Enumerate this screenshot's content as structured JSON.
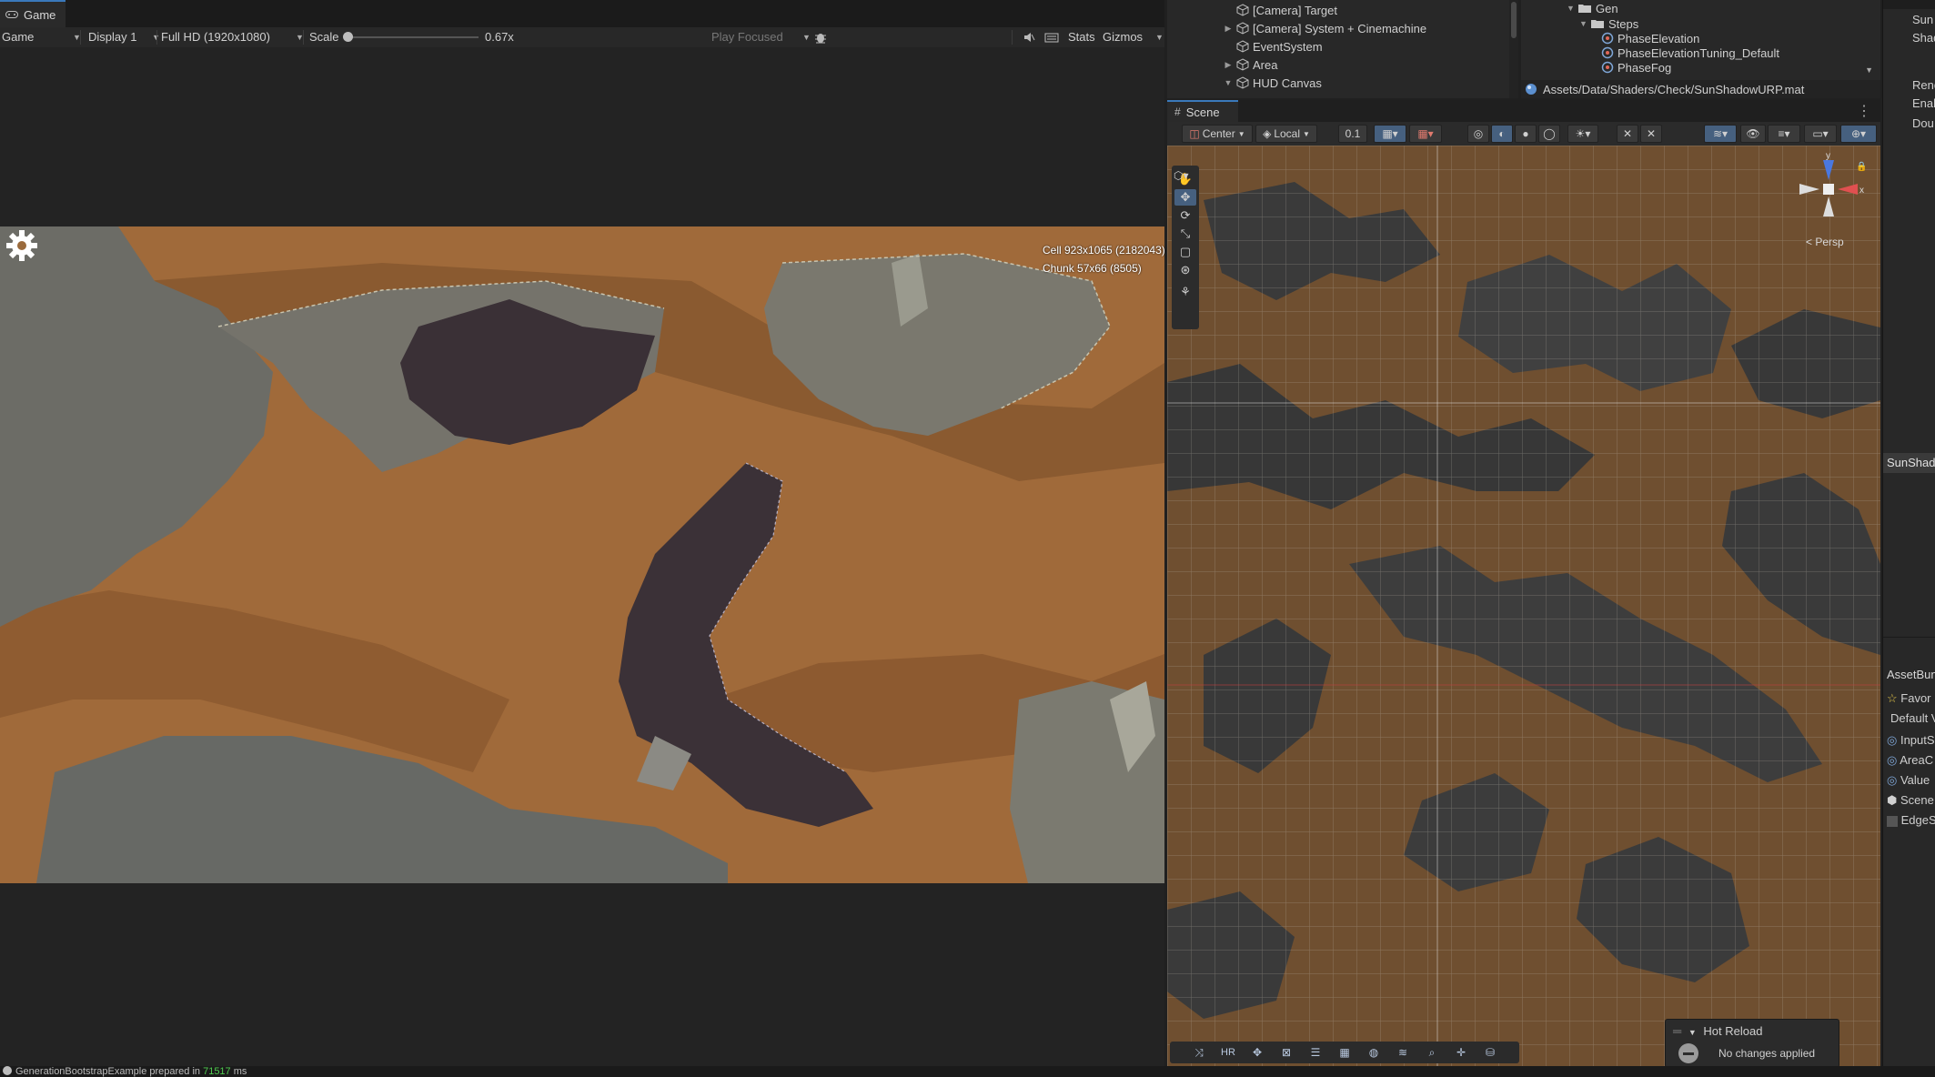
{
  "game": {
    "tab_label": "Game",
    "toolbar": {
      "mode": "Game",
      "display": "Display 1",
      "resolution": "Full HD (1920x1080)",
      "scale_label": "Scale",
      "scale_value": "0.67x",
      "play_mode": "Play Focused",
      "stats": "Stats",
      "gizmos": "Gizmos"
    },
    "overlay": {
      "cell": "Cell 923x1065 (2182043)",
      "chunk": "Chunk 57x66 (8505)"
    }
  },
  "hierarchy": {
    "items": [
      {
        "label": "[Camera] Target",
        "expanded": null
      },
      {
        "label": "[Camera] System + Cinemachine",
        "expanded": false
      },
      {
        "label": "EventSystem",
        "expanded": null
      },
      {
        "label": "Area",
        "expanded": false
      },
      {
        "label": "HUD Canvas",
        "expanded": true
      }
    ]
  },
  "project": {
    "tree": [
      {
        "label": "Gen",
        "kind": "folder"
      },
      {
        "label": "Steps",
        "kind": "folder"
      },
      {
        "label": "PhaseElevation",
        "kind": "asset"
      },
      {
        "label": "PhaseElevationTuning_Default",
        "kind": "asset"
      },
      {
        "label": "PhaseFog",
        "kind": "asset"
      }
    ],
    "selected_path": "Assets/Data/Shaders/Check/SunShadowURP.mat"
  },
  "scene": {
    "tab_label": "Scene",
    "toolbar": {
      "pivot": "Center",
      "space": "Local",
      "snap_value": "0.1"
    },
    "gizmo": {
      "y_axis": "y",
      "x_axis": "x",
      "projection": "< Persp"
    },
    "hot_reload": {
      "title": "Hot Reload",
      "status": "No changes applied"
    }
  },
  "inspector": {
    "items": [
      {
        "text": "Sun"
      },
      {
        "text": "Shad"
      },
      {
        "text": "Rend"
      },
      {
        "text": "Enab"
      },
      {
        "text": "Dou"
      },
      {
        "text": "SunShado"
      },
      {
        "text": "AssetBun"
      },
      {
        "text": "Favor"
      },
      {
        "text": "Default V"
      },
      {
        "text": "InputS"
      },
      {
        "text": "AreaC"
      },
      {
        "text": "Value"
      },
      {
        "text": "Scene"
      },
      {
        "text": "EdgeS"
      }
    ]
  },
  "status_bar": {
    "message_prefix": "GenerationBootstrapExample prepared in ",
    "message_value": "71517",
    "message_suffix": " ms"
  },
  "colors": {
    "accent": "#3a79bb",
    "dirt": "#a06a3a",
    "rock": "#6c6c66",
    "dark_rock": "#3a3036",
    "status_value": "#4ec94e"
  }
}
